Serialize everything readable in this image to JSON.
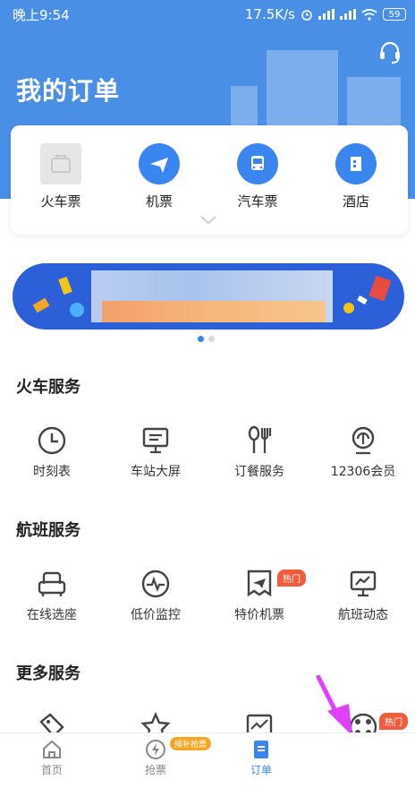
{
  "status_bar": {
    "time": "晚上9:54",
    "speed": "17.5K/s",
    "battery": "59"
  },
  "header": {
    "title": "我的订单"
  },
  "categories": [
    {
      "label": "火车票",
      "icon": "train-ticket-icon"
    },
    {
      "label": "机票",
      "icon": "airplane-icon"
    },
    {
      "label": "汽车票",
      "icon": "bus-icon"
    },
    {
      "label": "酒店",
      "icon": "hotel-icon"
    }
  ],
  "sections": {
    "train": {
      "title": "火车服务",
      "items": [
        {
          "label": "时刻表",
          "icon": "clock-icon"
        },
        {
          "label": "车站大屏",
          "icon": "monitor-icon"
        },
        {
          "label": "订餐服务",
          "icon": "cutlery-icon"
        },
        {
          "label": "12306会员",
          "icon": "member-icon"
        }
      ]
    },
    "flight": {
      "title": "航班服务",
      "items": [
        {
          "label": "在线选座",
          "icon": "seat-icon"
        },
        {
          "label": "低价监控",
          "icon": "price-monitor-icon"
        },
        {
          "label": "特价机票",
          "icon": "special-ticket-icon",
          "badge": "热门"
        },
        {
          "label": "航班动态",
          "icon": "flight-status-icon"
        }
      ]
    },
    "more": {
      "title": "更多服务",
      "hot_badge": "热门"
    }
  },
  "bottom_nav": {
    "items": [
      {
        "label": "首页",
        "icon": "home-icon"
      },
      {
        "label": "抢票",
        "icon": "grab-ticket-icon",
        "badge": "候补抢票"
      },
      {
        "label": "订单",
        "icon": "order-icon"
      }
    ],
    "active": "订单"
  },
  "colors": {
    "primary": "#4a8fe6",
    "accent": "#3a86f0",
    "hot": "#f25b3c",
    "arrow": "#e040fb"
  }
}
